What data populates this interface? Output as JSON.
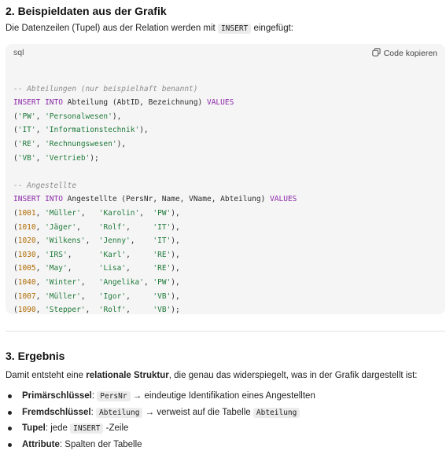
{
  "section2": {
    "heading": "2. Beispieldaten aus der Grafik",
    "intro_before": "Die Datenzeilen (Tupel) aus der Relation werden mit ",
    "intro_code": "INSERT",
    "intro_after": " eingefügt:"
  },
  "codeblock": {
    "lang": "sql",
    "copy_label": "Code kopieren",
    "abt_comment": "-- Abteilungen (nur beispielhaft benannt)",
    "abt_insert": "INSERT INTO Abteilung (AbtID, Bezeichnung) VALUES",
    "abt_rows": [
      [
        "'PW'",
        "'Personalwesen'",
        "),"
      ],
      [
        "'IT'",
        "'Informationstechnik'",
        "),"
      ],
      [
        "'RE'",
        "'Rechnungswesen'",
        "),"
      ],
      [
        "'VB'",
        "'Vertrieb'",
        ");"
      ]
    ],
    "ang_comment": "-- Angestellte",
    "ang_insert": "INSERT INTO Angestellte (PersNr, Name, VName, Abteilung) VALUES",
    "ang_rows": [
      [
        "1001",
        "'Müller',  ",
        "'Karolin', ",
        "'PW'",
        "),"
      ],
      [
        "1010",
        "'Jäger',   ",
        "'Rolf',    ",
        "'IT'",
        "),"
      ],
      [
        "1020",
        "'Wilkens', ",
        "'Jenny',   ",
        "'IT'",
        "),"
      ],
      [
        "1030",
        "'IRS',     ",
        "'Karl',    ",
        "'RE'",
        "),"
      ],
      [
        "1005",
        "'May',     ",
        "'Lisa',    ",
        "'RE'",
        "),"
      ],
      [
        "1040",
        "'Winter',  ",
        "'Angelika',",
        "'PW'",
        "),"
      ],
      [
        "1007",
        "'Müller',  ",
        "'Igor',    ",
        "'VB'",
        "),"
      ],
      [
        "1090",
        "'Stepper', ",
        "'Rolf',    ",
        "'VB'",
        ");"
      ]
    ]
  },
  "section3": {
    "heading": "3. Ergebnis",
    "text_before": "Damit entsteht eine ",
    "text_bold": "relationale Struktur",
    "text_after": ", die genau das widerspiegelt, was in der Grafik dargestellt ist:",
    "bullets": [
      {
        "label": "Primärschlüssel",
        "sep": ": ",
        "code": "PersNr",
        "text": " → eindeutige Identifikation eines Angestellten",
        "code2": ""
      },
      {
        "label": "Fremdschlüssel",
        "sep": ": ",
        "code": "Abteilung",
        "text": " → verweist auf die Tabelle ",
        "code2": "Abteilung"
      },
      {
        "label": "Tupel",
        "sep": ": jede ",
        "code": "INSERT",
        "text": " -Zeile",
        "code2": ""
      },
      {
        "label": "Attribute",
        "sep": ": Spalten der Tabelle",
        "code": "",
        "text": "",
        "code2": ""
      }
    ]
  }
}
